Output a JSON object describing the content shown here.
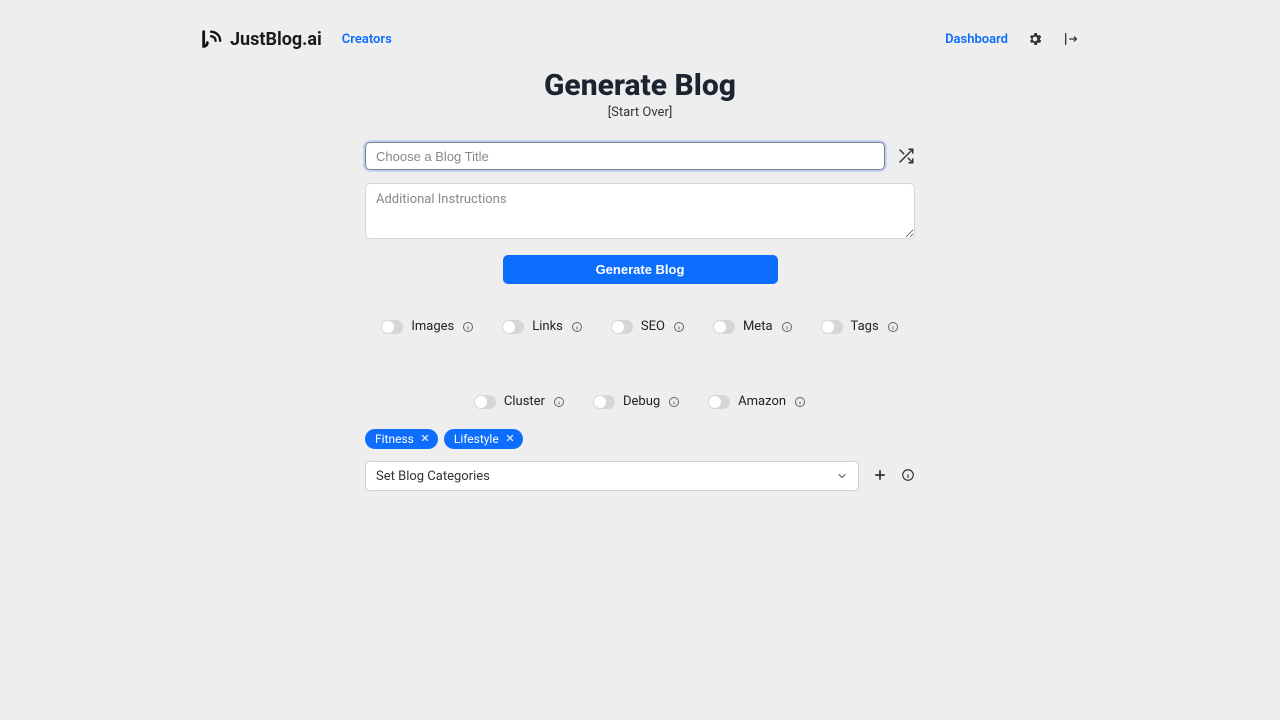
{
  "header": {
    "brand": "JustBlog.ai",
    "nav": {
      "creators": "Creators",
      "dashboard": "Dashboard"
    }
  },
  "page": {
    "title": "Generate Blog",
    "start_over": "[Start Over]"
  },
  "inputs": {
    "blog_title_placeholder": "Choose a Blog Title",
    "instructions_placeholder": "Additional Instructions"
  },
  "buttons": {
    "generate": "Generate Blog"
  },
  "toggles": {
    "row1": [
      {
        "label": "Images"
      },
      {
        "label": "Links"
      },
      {
        "label": "SEO"
      },
      {
        "label": "Meta"
      },
      {
        "label": "Tags"
      }
    ],
    "row2": [
      {
        "label": "Cluster"
      },
      {
        "label": "Debug"
      },
      {
        "label": "Amazon"
      }
    ]
  },
  "tags": [
    "Fitness",
    "Lifestyle"
  ],
  "categories": {
    "placeholder": "Set Blog Categories"
  }
}
